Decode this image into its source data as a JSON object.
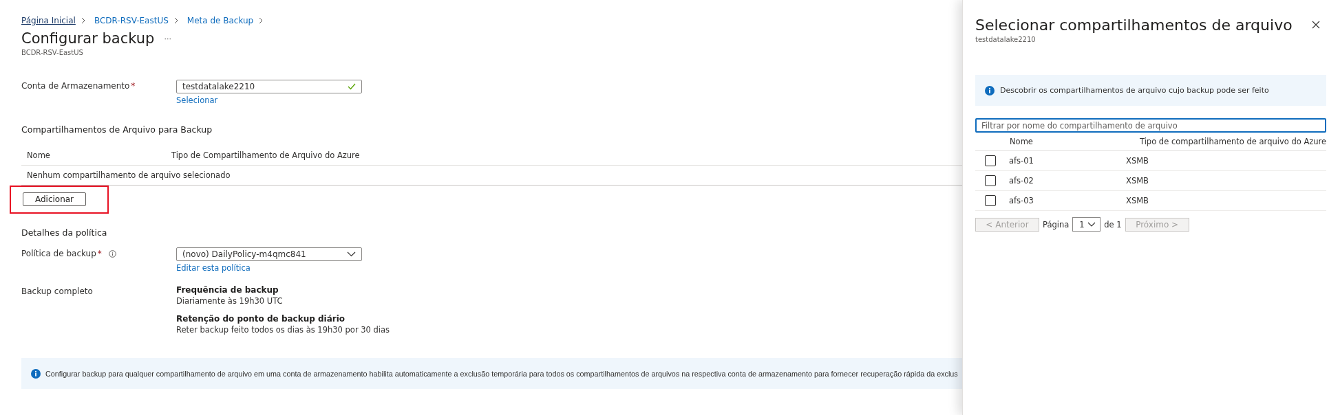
{
  "breadcrumb": [
    "Página Inicial",
    "BCDR-RSV-EastUS",
    "Meta de Backup"
  ],
  "page": {
    "title": "Configurar backup",
    "more": "···",
    "subtitle": "BCDR-RSV-EastUS"
  },
  "storage_account": {
    "label": "Conta de Armazenamento",
    "required_mark": "*",
    "value": "testdatalake2210",
    "valid": true,
    "link": "Selecionar"
  },
  "file_shares_section": {
    "heading": "Compartilhamentos de Arquivo para Backup",
    "columns": [
      "Nome",
      "Tipo de Compartilhamento de Arquivo do Azure"
    ],
    "empty_text": "Nenhum compartilhamento de arquivo selecionado",
    "add_button": {
      "label": "Adicionar",
      "highlighted": true
    }
  },
  "policy_section": {
    "heading": "Detalhes da política",
    "policy_label": "Política de backup",
    "required_mark": "*",
    "policy_value": "(novo) DailyPolicy-m4qmc841",
    "edit_link": "Editar esta política",
    "full_backup_label": "Backup completo",
    "details": [
      {
        "title": "Frequência de backup",
        "text": "Diariamente às 19h30 UTC"
      },
      {
        "title": "Retenção do ponto de backup diário",
        "text": "Reter backup feito todos os dias às 19h30 por 30 dias"
      }
    ]
  },
  "info_bar": "Configurar backup para qualquer compartilhamento de arquivo em uma conta de armazenamento habilita automaticamente a exclusão temporária para todos os compartilhamentos de arquivos na respectiva conta de armazenamento para fornecer recuperação rápida da exclus",
  "panel": {
    "title": "Selecionar compartilhamentos de arquivo",
    "subtitle": "testdatalake2210",
    "info": "Descobrir os compartilhamentos de arquivo cujo backup pode ser feito",
    "filter_placeholder": "Filtrar por nome do compartilhamento de arquivo",
    "columns": [
      "Nome",
      "Tipo de compartilhamento de arquivo do Azure"
    ],
    "rows": [
      {
        "name": "afs-01",
        "type": "XSMB",
        "checked": false
      },
      {
        "name": "afs-02",
        "type": "XSMB",
        "checked": false
      },
      {
        "name": "afs-03",
        "type": "XSMB",
        "checked": false
      }
    ],
    "pager": {
      "previous": "< Anterior",
      "page_label": "Página",
      "page": "1",
      "of": "de 1",
      "next": "Próximo >",
      "previous_disabled": true,
      "next_disabled": true
    }
  }
}
